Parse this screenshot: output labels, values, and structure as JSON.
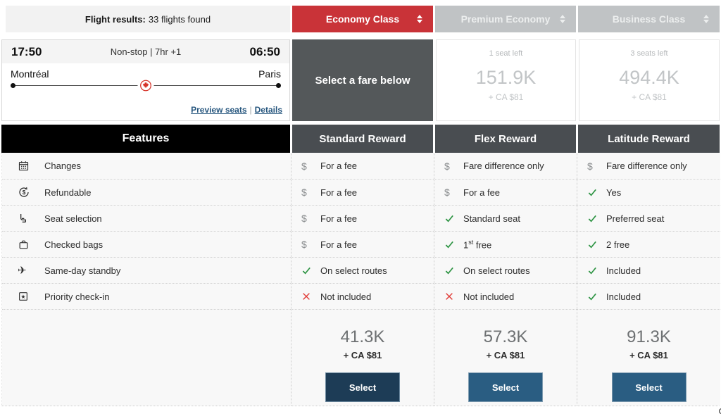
{
  "top_bar": {
    "label_bold": "Flight results:",
    "label_rest": "33 flights found"
  },
  "cabin_tabs": [
    {
      "label": "Economy Class",
      "selected": true
    },
    {
      "label": "Premium Economy",
      "selected": false
    },
    {
      "label": "Business Class",
      "selected": false
    }
  ],
  "flight": {
    "departure_time": "17:50",
    "route_info": "Non-stop | 7hr +1",
    "arrival_time": "06:50",
    "origin": "Montréal",
    "destination": "Paris",
    "links": {
      "preview_seats": "Preview seats",
      "separator": "|",
      "details": "Details"
    }
  },
  "fare_prompt": "Select a fare below",
  "cabin_fares": [
    {
      "seats_left": "1 seat left",
      "points": "151.9K",
      "cash": "+ CA $81"
    },
    {
      "seats_left": "3 seats left",
      "points": "494.4K",
      "cash": "+ CA $81"
    }
  ],
  "icons": {
    "dollar": "$",
    "plane": "✈",
    "star": "★"
  },
  "fare_table": {
    "features_header": "Features",
    "fare_headers": [
      "Standard Reward",
      "Flex Reward",
      "Latitude Reward"
    ],
    "rows": [
      {
        "feature": "Changes",
        "icon": "calendar",
        "standard": {
          "icon": "dollar",
          "text": "For a fee"
        },
        "flex": {
          "icon": "dollar",
          "text": "Fare difference only"
        },
        "latitude": {
          "icon": "dollar",
          "text": "Fare difference only"
        }
      },
      {
        "feature": "Refundable",
        "icon": "refund-dollar",
        "standard": {
          "icon": "dollar",
          "text": "For a fee"
        },
        "flex": {
          "icon": "dollar",
          "text": "For a fee"
        },
        "latitude": {
          "icon": "check",
          "text": "Yes"
        }
      },
      {
        "feature": "Seat selection",
        "icon": "seat",
        "standard": {
          "icon": "dollar",
          "text": "For a fee"
        },
        "flex": {
          "icon": "check",
          "text": "Standard seat"
        },
        "latitude": {
          "icon": "check",
          "text": "Preferred seat"
        }
      },
      {
        "feature": "Checked bags",
        "icon": "suitcase",
        "standard": {
          "icon": "dollar",
          "text": "For a fee"
        },
        "flex": {
          "icon": "check",
          "num": "1",
          "sup": "st",
          "rest": " free"
        },
        "latitude": {
          "icon": "check",
          "text": "2 free"
        }
      },
      {
        "feature": "Same-day standby",
        "icon": "plane-clock",
        "standard": {
          "icon": "check",
          "text": "On select routes"
        },
        "flex": {
          "icon": "check",
          "text": "On select routes"
        },
        "latitude": {
          "icon": "check",
          "text": "Included"
        }
      },
      {
        "feature": "Priority check-in",
        "icon": "star-badge",
        "standard": {
          "icon": "cross",
          "text": "Not included"
        },
        "flex": {
          "icon": "cross",
          "text": "Not included"
        },
        "latitude": {
          "icon": "check",
          "text": "Included"
        }
      }
    ],
    "pricing": [
      {
        "points": "41.3K",
        "cash": "+ CA $81",
        "button": "Select"
      },
      {
        "points": "57.3K",
        "cash": "+ CA $81",
        "button": "Select"
      },
      {
        "points": "91.3K",
        "cash": "+ CA $81",
        "button": "Select"
      }
    ]
  },
  "colors": {
    "brand_red": "#c93338",
    "tab_gray": "#c0c3c5",
    "slate_box": "#54585a",
    "header_dark": "#494d51",
    "features_black": "#000000",
    "link_blue": "#26567e",
    "button_dark_navy": "#1d3c56",
    "button_steel_blue": "#2a5d82",
    "check_green": "#2e9444",
    "cross_red": "#e13c38"
  }
}
